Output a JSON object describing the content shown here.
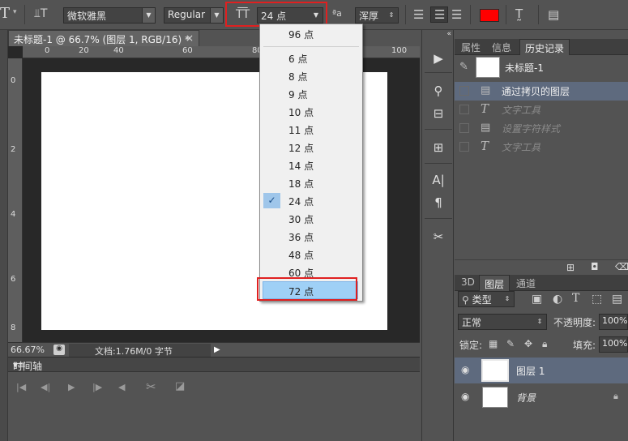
{
  "options_bar": {
    "tool_icon": "T",
    "font_family": "微软雅黑",
    "font_style": "Regular",
    "font_size": "24 点",
    "aa_method": "浑厚",
    "color_swatch": "#ff0000",
    "aa_label": "ªa"
  },
  "document": {
    "tab_title": "未标题-1 @ 66.7% (图层 1, RGB/16) *",
    "close": "×",
    "zoom": "66.67%",
    "doc_info": "文档:1.76M/0 字节",
    "ruler_h": [
      "0",
      "20",
      "40",
      "60",
      "80",
      "100"
    ],
    "ruler_v": [
      "0",
      "2",
      "4",
      "6",
      "8"
    ]
  },
  "timeline": {
    "title": "时间轴"
  },
  "font_size_list": {
    "items": [
      "96 点",
      "6 点",
      "8 点",
      "9 点",
      "10 点",
      "11 点",
      "12 点",
      "14 点",
      "18 点",
      "24 点",
      "30 点",
      "36 点",
      "48 点",
      "60 点",
      "72 点"
    ],
    "checked": "24 点",
    "highlighted": "72 点",
    "check_mark": "✓"
  },
  "panels": {
    "top_tabs": [
      "属性",
      "信息",
      "历史记录"
    ],
    "active_top_tab": "历史记录",
    "snapshot_name": "未标题-1",
    "history": [
      {
        "label": "通过拷贝的图层",
        "icon": "doc-icon",
        "active": true
      },
      {
        "label": "文字工具",
        "icon": "type-icon",
        "active": false
      },
      {
        "label": "设置字符样式",
        "icon": "doc-icon",
        "active": false
      },
      {
        "label": "文字工具",
        "icon": "type-icon",
        "active": false
      }
    ],
    "layer_tabs": [
      "3D",
      "图层",
      "通道"
    ],
    "active_layer_tab": "图层",
    "filter_kind": "类型",
    "blend_mode": "正常",
    "opacity_label": "不透明度:",
    "opacity_value": "100%",
    "lock_label": "锁定:",
    "fill_label": "填充:",
    "fill_value": "100%",
    "layers": [
      {
        "name": "图层 1",
        "selected": true
      },
      {
        "name": "背景",
        "selected": false,
        "locked": true
      }
    ]
  },
  "colors": {
    "panel_bg": "#535353",
    "selection": "#5e6a7e",
    "highlight_blue": "#9fd0f6",
    "annotation_red": "#e02020"
  }
}
